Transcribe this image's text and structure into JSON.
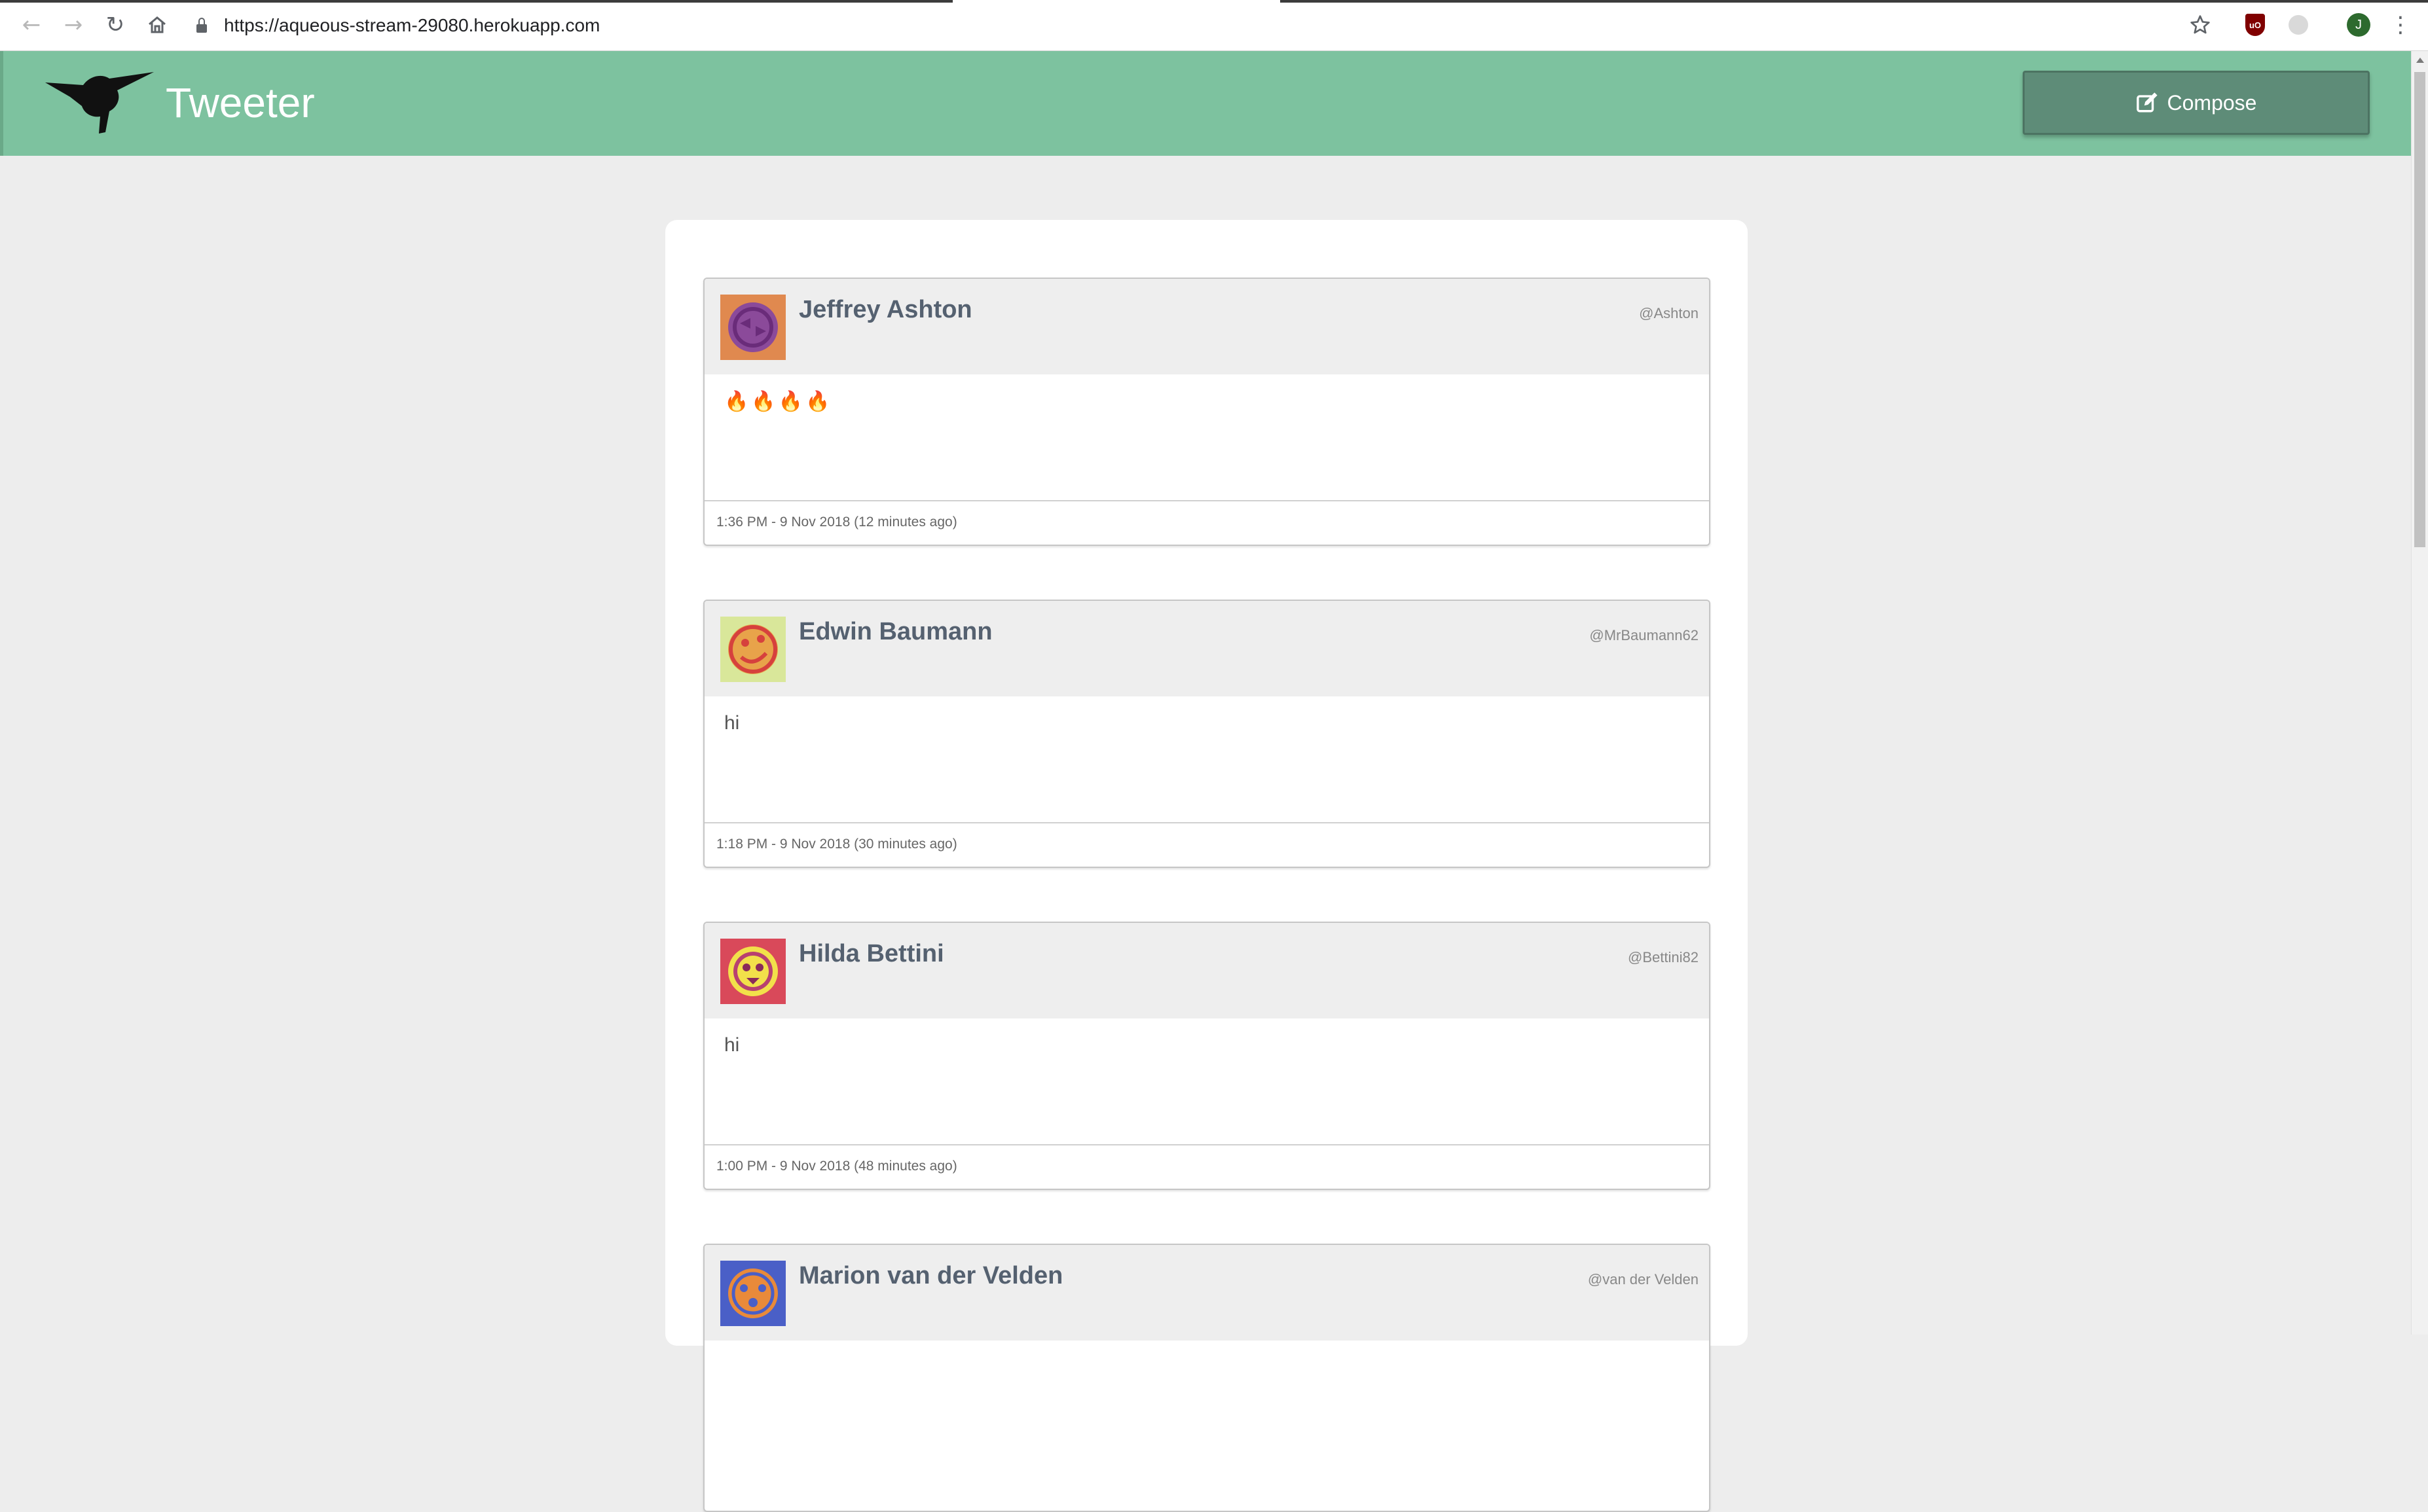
{
  "browser": {
    "url": "https://aqueous-stream-29080.herokuapp.com",
    "back_icon": "arrow-left-icon",
    "forward_icon": "arrow-right-icon",
    "reload_icon": "reload-icon",
    "home_icon": "home-icon",
    "bookmark_icon": "star-icon",
    "profile_initial": "J",
    "extension_badge": "uO",
    "menu_glyph": "⋮"
  },
  "header": {
    "brand": "Tweeter",
    "logo_icon": "hummingbird-icon",
    "compose_label": "Compose",
    "compose_icon": "edit-icon",
    "header_color": "#7dc29f"
  },
  "tweets": [
    {
      "name": "Jeffrey Ashton",
      "handle": "@Ashton",
      "body": "🔥🔥🔥🔥",
      "timestamp": "1:36 PM - 9 Nov 2018 (12 minutes ago)",
      "avatar_bg": "#e0894f",
      "avatar_fg": "#6a2c7a",
      "avatar_icon": "robot-face-icon"
    },
    {
      "name": "Edwin Baumann",
      "handle": "@MrBaumann62",
      "body": "hi",
      "timestamp": "1:18 PM - 9 Nov 2018 (30 minutes ago)",
      "avatar_bg": "#d9e79a",
      "avatar_fg": "#d6413d",
      "avatar_icon": "robot-face-icon"
    },
    {
      "name": "Hilda Bettini",
      "handle": "@Bettini82",
      "body": "hi",
      "timestamp": "1:00 PM - 9 Nov 2018 (48 minutes ago)",
      "avatar_bg": "#d9495a",
      "avatar_fg": "#f2e04a",
      "avatar_icon": "robot-face-icon"
    },
    {
      "name": "Marion van der Velden",
      "handle": "@van der Velden",
      "avatar_bg": "#4a5fc7",
      "avatar_fg": "#e98a3a",
      "avatar_icon": "robot-face-icon"
    }
  ]
}
